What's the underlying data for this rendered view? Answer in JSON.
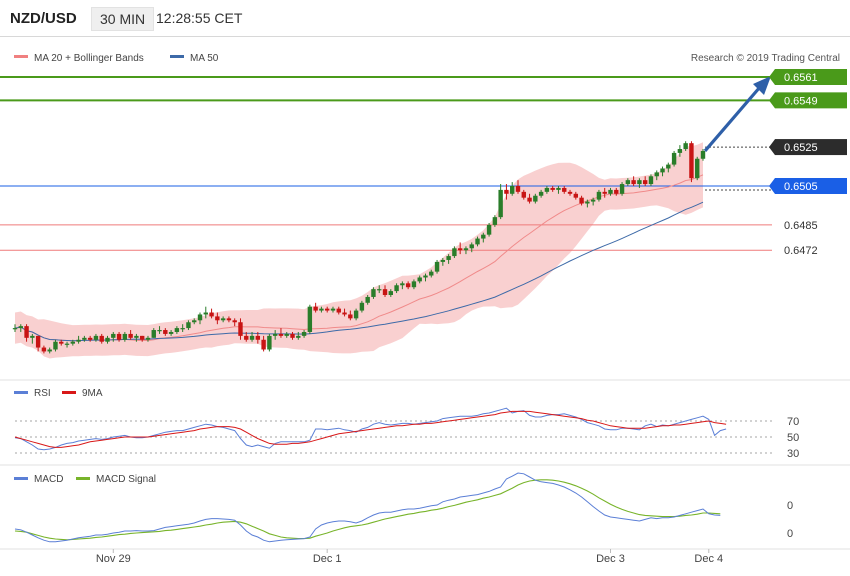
{
  "header": {
    "symbol": "NZD/USD",
    "timeframe": "30 MIN",
    "time": "12:28:55 CET"
  },
  "legend": {
    "bb": "MA 20 + Bollinger Bands",
    "ma50": "MA 50",
    "credit": "Research © 2019 Trading Central"
  },
  "levels": [
    {
      "label": "0.6561",
      "value": 0.6561,
      "kind": "resistance",
      "color": "#4a9a1a"
    },
    {
      "label": "0.6549",
      "value": 0.6549,
      "kind": "resistance",
      "color": "#4a9a1a"
    },
    {
      "label": "0.6525",
      "value": 0.6525,
      "kind": "last",
      "color": "#2c2c2c"
    },
    {
      "label": "0.6505",
      "value": 0.6505,
      "kind": "pivot",
      "color": "#1a5fe6"
    },
    {
      "label": "0.6485",
      "value": 0.6485,
      "kind": "support",
      "color": "#ef7a7a"
    },
    {
      "label": "0.6472",
      "value": 0.6472,
      "kind": "support",
      "color": "#ef7a7a"
    }
  ],
  "rsi": {
    "legend_rsi": "RSI",
    "legend_ma": "9MA",
    "ticks": [
      "70",
      "50",
      "30"
    ]
  },
  "macd": {
    "legend_macd": "MACD",
    "legend_signal": "MACD Signal",
    "ticks": [
      "0",
      "0"
    ]
  },
  "xaxis": {
    "labels": [
      "Nov 29",
      "Dec 1",
      "Dec 3",
      "Dec 4"
    ]
  },
  "colors": {
    "up": "#2a7d2a",
    "down": "#c81414",
    "band": "#f8c8c8",
    "ma50": "#3d6aa8",
    "rsi": "#5b7fd6",
    "rsi_ma": "#d81818",
    "macd": "#5b7fd6",
    "signal": "#78b42a"
  },
  "chart_data": {
    "type": "candlestick",
    "price_range": [
      0.6405,
      0.6565
    ],
    "candles_ohlc": [
      [
        0.6432,
        0.6434,
        0.643,
        0.6432
      ],
      [
        0.6432,
        0.6434,
        0.643,
        0.6433
      ],
      [
        0.6433,
        0.6434,
        0.6425,
        0.6427
      ],
      [
        0.6427,
        0.6429,
        0.6424,
        0.6428
      ],
      [
        0.6428,
        0.6428,
        0.642,
        0.6422
      ],
      [
        0.6422,
        0.6423,
        0.6419,
        0.642
      ],
      [
        0.642,
        0.6422,
        0.6419,
        0.6421
      ],
      [
        0.6421,
        0.6426,
        0.642,
        0.6425
      ],
      [
        0.6425,
        0.6426,
        0.6423,
        0.6424
      ],
      [
        0.6424,
        0.6425,
        0.6422,
        0.6424
      ],
      [
        0.6424,
        0.6426,
        0.6423,
        0.6425
      ],
      [
        0.6425,
        0.6428,
        0.6424,
        0.6426
      ],
      [
        0.6426,
        0.6428,
        0.6425,
        0.6427
      ],
      [
        0.6427,
        0.6428,
        0.6425,
        0.6426
      ],
      [
        0.6426,
        0.6429,
        0.6425,
        0.6428
      ],
      [
        0.6428,
        0.6429,
        0.6424,
        0.6425
      ],
      [
        0.6425,
        0.6428,
        0.6424,
        0.6427
      ],
      [
        0.6427,
        0.643,
        0.6425,
        0.6429
      ],
      [
        0.6429,
        0.643,
        0.6425,
        0.6426
      ],
      [
        0.6426,
        0.643,
        0.6425,
        0.6429
      ],
      [
        0.6429,
        0.6431,
        0.6426,
        0.6427
      ],
      [
        0.6427,
        0.6429,
        0.6425,
        0.6428
      ],
      [
        0.6428,
        0.6428,
        0.6425,
        0.6426
      ],
      [
        0.6426,
        0.6428,
        0.6425,
        0.6427
      ],
      [
        0.6427,
        0.6432,
        0.6427,
        0.6431
      ],
      [
        0.6431,
        0.6433,
        0.6429,
        0.6431
      ],
      [
        0.6431,
        0.6432,
        0.6428,
        0.6429
      ],
      [
        0.6429,
        0.6431,
        0.6428,
        0.643
      ],
      [
        0.643,
        0.6433,
        0.6429,
        0.6432
      ],
      [
        0.6432,
        0.6434,
        0.643,
        0.6432
      ],
      [
        0.6432,
        0.6436,
        0.6431,
        0.6435
      ],
      [
        0.6435,
        0.6437,
        0.6434,
        0.6436
      ],
      [
        0.6436,
        0.644,
        0.6434,
        0.6439
      ],
      [
        0.6439,
        0.6443,
        0.6437,
        0.644
      ],
      [
        0.644,
        0.6442,
        0.6437,
        0.6438
      ],
      [
        0.6438,
        0.644,
        0.6434,
        0.6436
      ],
      [
        0.6436,
        0.6438,
        0.6435,
        0.6437
      ],
      [
        0.6437,
        0.6438,
        0.6435,
        0.6436
      ],
      [
        0.6436,
        0.6437,
        0.6433,
        0.6435
      ],
      [
        0.6435,
        0.6437,
        0.6426,
        0.6428
      ],
      [
        0.6428,
        0.643,
        0.6425,
        0.6426
      ],
      [
        0.6426,
        0.643,
        0.6425,
        0.6428
      ],
      [
        0.6428,
        0.643,
        0.6424,
        0.6426
      ],
      [
        0.6426,
        0.6428,
        0.642,
        0.6421
      ],
      [
        0.6421,
        0.6429,
        0.642,
        0.6428
      ],
      [
        0.6428,
        0.6431,
        0.6426,
        0.6429
      ],
      [
        0.6429,
        0.6432,
        0.6427,
        0.6428
      ],
      [
        0.6428,
        0.643,
        0.6427,
        0.6429
      ],
      [
        0.6429,
        0.643,
        0.6426,
        0.6427
      ],
      [
        0.6427,
        0.643,
        0.6426,
        0.6428
      ],
      [
        0.6428,
        0.6431,
        0.6427,
        0.643
      ],
      [
        0.643,
        0.6444,
        0.6429,
        0.6443
      ],
      [
        0.6443,
        0.6445,
        0.644,
        0.6441
      ],
      [
        0.6441,
        0.6443,
        0.644,
        0.6442
      ],
      [
        0.6442,
        0.6443,
        0.644,
        0.6441
      ],
      [
        0.6441,
        0.6443,
        0.644,
        0.6442
      ],
      [
        0.6442,
        0.6443,
        0.6439,
        0.644
      ],
      [
        0.644,
        0.6442,
        0.6438,
        0.6439
      ],
      [
        0.6439,
        0.6441,
        0.6436,
        0.6437
      ],
      [
        0.6437,
        0.6442,
        0.6436,
        0.6441
      ],
      [
        0.6441,
        0.6446,
        0.644,
        0.6445
      ],
      [
        0.6445,
        0.6449,
        0.6444,
        0.6448
      ],
      [
        0.6448,
        0.6453,
        0.6447,
        0.6452
      ],
      [
        0.6452,
        0.6454,
        0.645,
        0.6452
      ],
      [
        0.6452,
        0.6454,
        0.6448,
        0.6449
      ],
      [
        0.6449,
        0.6452,
        0.6448,
        0.6451
      ],
      [
        0.6451,
        0.6455,
        0.645,
        0.6454
      ],
      [
        0.6454,
        0.6456,
        0.6452,
        0.6455
      ],
      [
        0.6455,
        0.6456,
        0.6452,
        0.6453
      ],
      [
        0.6453,
        0.6457,
        0.6452,
        0.6456
      ],
      [
        0.6456,
        0.6459,
        0.6455,
        0.6458
      ],
      [
        0.6458,
        0.646,
        0.6456,
        0.6459
      ],
      [
        0.6459,
        0.6462,
        0.6458,
        0.6461
      ],
      [
        0.6461,
        0.6467,
        0.646,
        0.6466
      ],
      [
        0.6466,
        0.6468,
        0.6464,
        0.6467
      ],
      [
        0.6467,
        0.647,
        0.6465,
        0.6469
      ],
      [
        0.6469,
        0.6474,
        0.6468,
        0.6473
      ],
      [
        0.6473,
        0.6476,
        0.647,
        0.6472
      ],
      [
        0.6472,
        0.6474,
        0.647,
        0.6473
      ],
      [
        0.6473,
        0.6476,
        0.6471,
        0.6475
      ],
      [
        0.6475,
        0.6479,
        0.6474,
        0.6478
      ],
      [
        0.6478,
        0.6481,
        0.6476,
        0.648
      ],
      [
        0.648,
        0.6486,
        0.6479,
        0.6485
      ],
      [
        0.6485,
        0.649,
        0.6484,
        0.6489
      ],
      [
        0.6489,
        0.6506,
        0.6488,
        0.6503
      ],
      [
        0.6503,
        0.6506,
        0.6498,
        0.6501
      ],
      [
        0.6501,
        0.6507,
        0.65,
        0.6505
      ],
      [
        0.6505,
        0.6508,
        0.6501,
        0.6502
      ],
      [
        0.6502,
        0.6503,
        0.6498,
        0.6499
      ],
      [
        0.6499,
        0.6501,
        0.6496,
        0.6497
      ],
      [
        0.6497,
        0.6501,
        0.6496,
        0.65
      ],
      [
        0.65,
        0.6503,
        0.6499,
        0.6502
      ],
      [
        0.6502,
        0.6505,
        0.6501,
        0.6504
      ],
      [
        0.6504,
        0.6505,
        0.6502,
        0.6503
      ],
      [
        0.6503,
        0.6505,
        0.6501,
        0.6504
      ],
      [
        0.6504,
        0.6505,
        0.6501,
        0.6502
      ],
      [
        0.6502,
        0.6503,
        0.65,
        0.6501
      ],
      [
        0.6501,
        0.6502,
        0.6498,
        0.6499
      ],
      [
        0.6499,
        0.65,
        0.6495,
        0.6496
      ],
      [
        0.6496,
        0.6498,
        0.6494,
        0.6497
      ],
      [
        0.6497,
        0.6499,
        0.6495,
        0.6498
      ],
      [
        0.6498,
        0.6503,
        0.6497,
        0.6502
      ],
      [
        0.6502,
        0.6504,
        0.6499,
        0.6501
      ],
      [
        0.6501,
        0.6504,
        0.65,
        0.6503
      ],
      [
        0.6503,
        0.6504,
        0.65,
        0.6501
      ],
      [
        0.6501,
        0.6507,
        0.65,
        0.6506
      ],
      [
        0.6506,
        0.6509,
        0.6505,
        0.6508
      ],
      [
        0.6508,
        0.651,
        0.6505,
        0.6506
      ],
      [
        0.6506,
        0.6509,
        0.6504,
        0.6508
      ],
      [
        0.6508,
        0.651,
        0.6505,
        0.6506
      ],
      [
        0.6506,
        0.6511,
        0.6505,
        0.651
      ],
      [
        0.651,
        0.6513,
        0.6508,
        0.6512
      ],
      [
        0.6512,
        0.6515,
        0.651,
        0.6514
      ],
      [
        0.6514,
        0.6517,
        0.6512,
        0.6516
      ],
      [
        0.6516,
        0.6523,
        0.6515,
        0.6522
      ],
      [
        0.6522,
        0.6526,
        0.652,
        0.6524
      ],
      [
        0.6524,
        0.6528,
        0.6523,
        0.6527
      ],
      [
        0.6527,
        0.6528,
        0.6507,
        0.6509
      ],
      [
        0.6509,
        0.652,
        0.6508,
        0.6519
      ],
      [
        0.6519,
        0.6524,
        0.6518,
        0.6523
      ]
    ],
    "rsi": [
      49,
      48,
      44,
      40,
      35,
      34,
      35,
      37,
      40,
      42,
      43,
      45,
      46,
      47,
      48,
      47,
      48,
      50,
      51,
      52,
      50,
      49,
      49,
      50,
      52,
      54,
      56,
      57,
      58,
      58,
      60,
      62,
      64,
      66,
      65,
      63,
      62,
      60,
      58,
      48,
      40,
      38,
      40,
      38,
      36,
      42,
      44,
      44,
      44,
      44,
      44,
      46,
      60,
      60,
      59,
      60,
      61,
      59,
      58,
      56,
      60,
      62,
      66,
      68,
      66,
      65,
      66,
      67,
      67,
      66,
      67,
      68,
      69,
      70,
      73,
      74,
      75,
      76,
      76,
      76,
      77,
      79,
      80,
      82,
      84,
      86,
      80,
      82,
      83,
      77,
      75,
      75,
      77,
      78,
      78,
      79,
      77,
      75,
      72,
      68,
      66,
      64,
      60,
      59,
      59,
      61,
      61,
      60,
      59,
      64,
      66,
      63,
      65,
      64,
      66,
      68,
      70,
      72,
      74,
      76,
      72,
      52,
      58,
      60
    ],
    "rsi_ma": [
      50,
      48,
      46,
      44,
      42,
      40,
      38,
      37,
      37,
      38,
      39,
      40,
      42,
      44,
      45,
      46,
      47,
      48,
      49,
      50,
      50,
      50,
      50,
      50,
      51,
      52,
      53,
      54,
      55,
      56,
      57,
      58,
      60,
      61,
      62,
      63,
      63,
      63,
      62,
      60,
      56,
      52,
      48,
      45,
      42,
      41,
      41,
      41,
      42,
      42,
      43,
      44,
      46,
      48,
      50,
      52,
      54,
      55,
      56,
      57,
      58,
      59,
      60,
      61,
      62,
      63,
      64,
      64,
      65,
      66,
      66,
      67,
      67,
      68,
      69,
      70,
      71,
      72,
      73,
      74,
      75,
      76,
      77,
      78,
      80,
      81,
      82,
      82,
      82,
      82,
      81,
      80,
      79,
      78,
      77,
      76,
      75,
      74,
      73,
      71,
      70,
      68,
      66,
      64,
      63,
      62,
      61,
      61,
      61,
      61,
      62,
      63,
      64,
      64,
      65,
      65,
      66,
      67,
      68,
      69,
      70,
      68,
      67,
      66
    ],
    "macd": [
      0.1,
      0.08,
      0.02,
      -0.05,
      -0.12,
      -0.18,
      -0.22,
      -0.22,
      -0.2,
      -0.18,
      -0.15,
      -0.12,
      -0.1,
      -0.08,
      -0.05,
      -0.05,
      -0.03,
      0.0,
      0.02,
      0.05,
      0.05,
      0.06,
      0.05,
      0.05,
      0.06,
      0.1,
      0.14,
      0.16,
      0.18,
      0.2,
      0.22,
      0.25,
      0.3,
      0.34,
      0.36,
      0.36,
      0.35,
      0.34,
      0.32,
      0.2,
      0.05,
      -0.05,
      -0.1,
      -0.18,
      -0.22,
      -0.2,
      -0.18,
      -0.17,
      -0.16,
      -0.15,
      -0.14,
      -0.1,
      0.1,
      0.2,
      0.25,
      0.28,
      0.3,
      0.3,
      0.28,
      0.25,
      0.3,
      0.38,
      0.45,
      0.5,
      0.52,
      0.52,
      0.55,
      0.58,
      0.6,
      0.6,
      0.62,
      0.65,
      0.68,
      0.7,
      0.78,
      0.82,
      0.85,
      0.9,
      0.92,
      0.94,
      0.96,
      1.0,
      1.04,
      1.1,
      1.15,
      1.35,
      1.42,
      1.5,
      1.48,
      1.4,
      1.32,
      1.28,
      1.26,
      1.24,
      1.2,
      1.15,
      1.08,
      1.0,
      0.9,
      0.78,
      0.66,
      0.55,
      0.45,
      0.4,
      0.38,
      0.36,
      0.34,
      0.32,
      0.3,
      0.34,
      0.38,
      0.36,
      0.38,
      0.38,
      0.4,
      0.44,
      0.48,
      0.52,
      0.56,
      0.6,
      0.48,
      0.45,
      0.44
    ],
    "macd_signal": [
      0.05,
      0.04,
      0.02,
      -0.02,
      -0.06,
      -0.1,
      -0.13,
      -0.15,
      -0.16,
      -0.17,
      -0.16,
      -0.15,
      -0.14,
      -0.13,
      -0.11,
      -0.1,
      -0.08,
      -0.06,
      -0.04,
      -0.03,
      -0.01,
      0.0,
      0.01,
      0.02,
      0.03,
      0.04,
      0.06,
      0.07,
      0.09,
      0.11,
      0.13,
      0.15,
      0.17,
      0.2,
      0.22,
      0.25,
      0.27,
      0.28,
      0.29,
      0.27,
      0.23,
      0.17,
      0.11,
      0.05,
      -0.02,
      -0.06,
      -0.1,
      -0.12,
      -0.13,
      -0.14,
      -0.14,
      -0.13,
      -0.08,
      -0.04,
      0.0,
      0.05,
      0.09,
      0.13,
      0.16,
      0.18,
      0.2,
      0.23,
      0.27,
      0.31,
      0.35,
      0.38,
      0.41,
      0.44,
      0.47,
      0.49,
      0.52,
      0.54,
      0.57,
      0.59,
      0.62,
      0.66,
      0.69,
      0.73,
      0.77,
      0.8,
      0.83,
      0.87,
      0.9,
      0.94,
      0.98,
      1.05,
      1.12,
      1.2,
      1.26,
      1.3,
      1.32,
      1.33,
      1.33,
      1.32,
      1.3,
      1.27,
      1.23,
      1.18,
      1.12,
      1.05,
      0.97,
      0.88,
      0.8,
      0.72,
      0.65,
      0.59,
      0.54,
      0.5,
      0.46,
      0.44,
      0.43,
      0.42,
      0.41,
      0.41,
      0.41,
      0.42,
      0.44,
      0.45,
      0.47,
      0.5,
      0.5,
      0.49,
      0.48
    ]
  }
}
